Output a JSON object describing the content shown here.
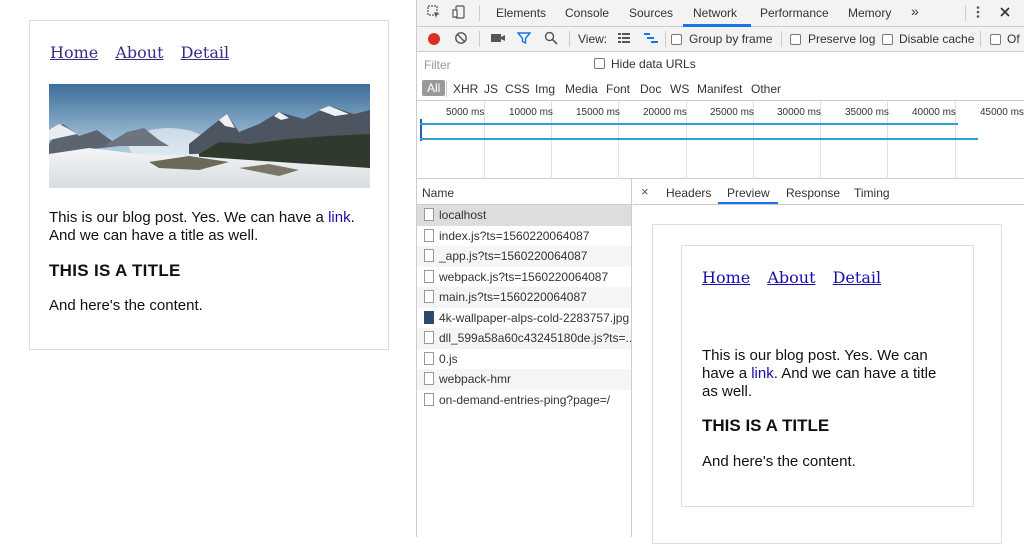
{
  "blog": {
    "nav": [
      "Home",
      "About",
      "Detail"
    ],
    "hero_image_alt": "mountain landscape",
    "text_before_link": "This is our blog post. Yes. We can have a ",
    "link_text": "link",
    "text_after_link": ". And we can have a title as well.",
    "title": "THIS IS A TITLE",
    "content": "And here's the content."
  },
  "devtools": {
    "tabs": [
      "Elements",
      "Console",
      "Sources",
      "Network",
      "Performance",
      "Memory"
    ],
    "active_tab": "Network",
    "more_tabs": "»",
    "toolbar": {
      "view_label": "View:",
      "group_by_frame": "Group by frame",
      "preserve_log": "Preserve log",
      "disable_cache": "Disable cache",
      "offline": "Of"
    },
    "filter_placeholder": "Filter",
    "hide_data_urls": "Hide data URLs",
    "types": [
      "All",
      "XHR",
      "JS",
      "CSS",
      "Img",
      "Media",
      "Font",
      "Doc",
      "WS",
      "Manifest",
      "Other"
    ],
    "timeline_ticks": [
      "5000 ms",
      "10000 ms",
      "15000 ms",
      "20000 ms",
      "25000 ms",
      "30000 ms",
      "35000 ms",
      "40000 ms",
      "45000 ms"
    ],
    "name_header": "Name",
    "requests": [
      "localhost",
      "index.js?ts=1560220064087",
      "_app.js?ts=1560220064087",
      "webpack.js?ts=1560220064087",
      "main.js?ts=1560220064087",
      "4k-wallpaper-alps-cold-2283757.jpg",
      "dll_599a58a60c43245180de.js?ts=...",
      "0.js",
      "webpack-hmr",
      "on-demand-entries-ping?page=/"
    ],
    "detail_tabs": [
      "Headers",
      "Preview",
      "Response",
      "Timing"
    ],
    "active_detail_tab": "Preview",
    "close_symbol": "×"
  },
  "colors": {
    "accent": "#1a73e8",
    "record": "#d93025",
    "link": "#1a0dab",
    "nav_link": "#3a2a8a"
  }
}
